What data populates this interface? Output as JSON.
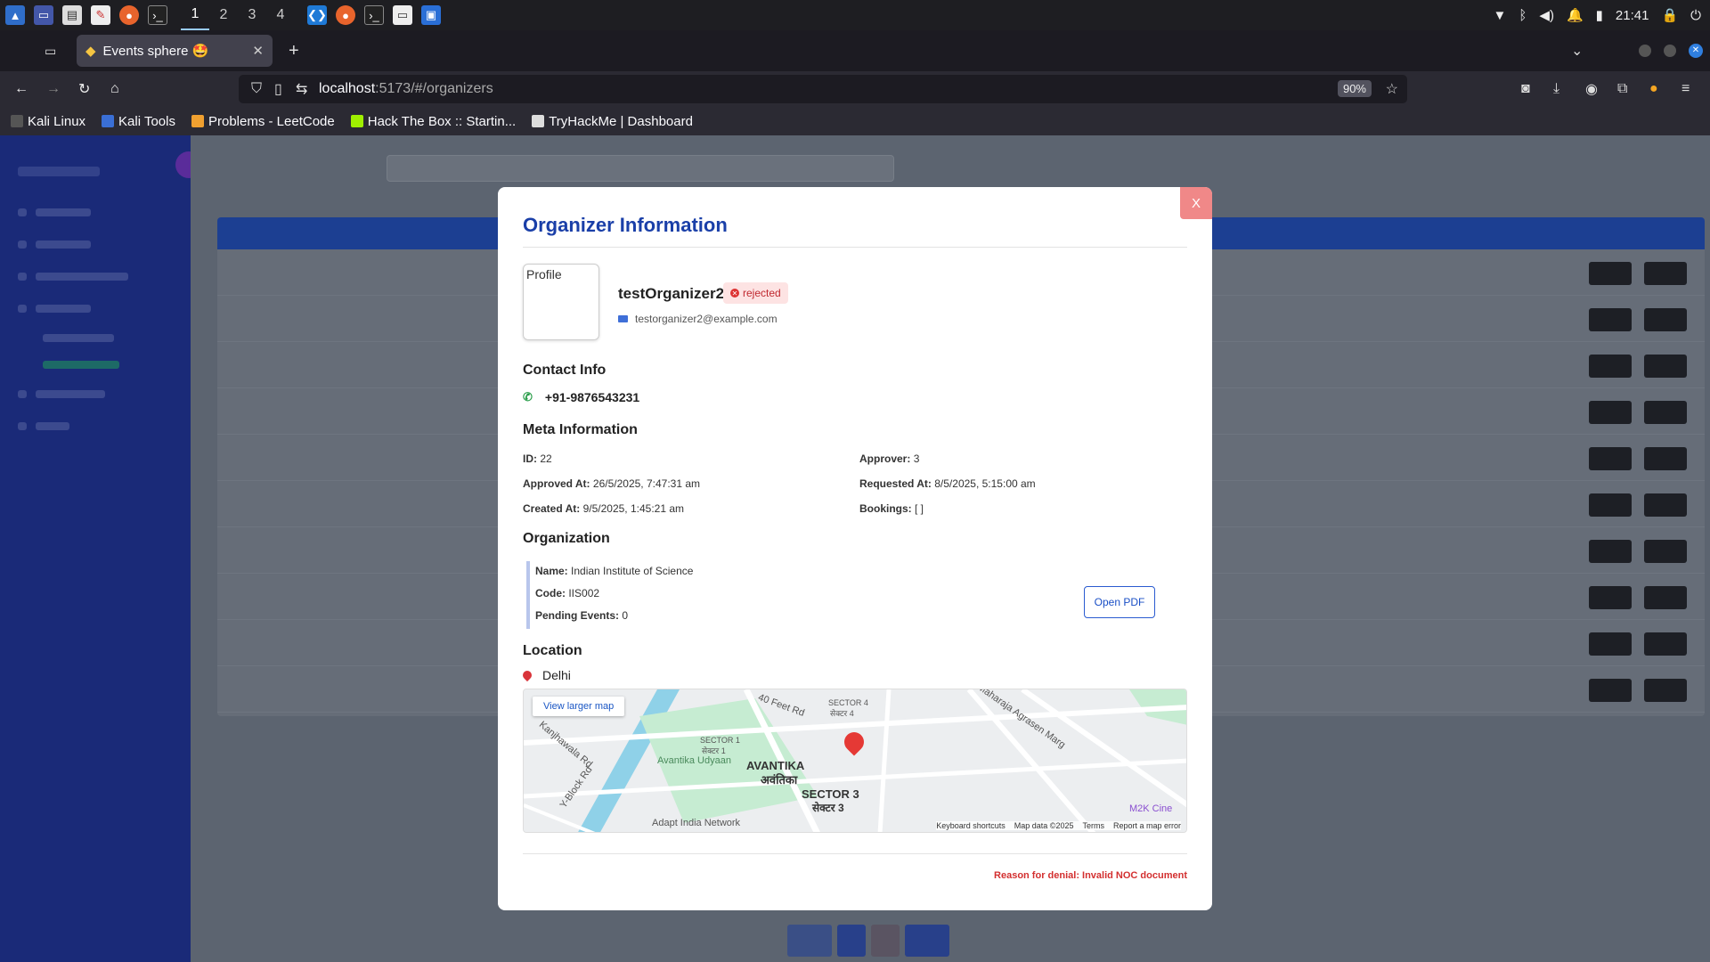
{
  "taskbar": {
    "workspaces": [
      "1",
      "2",
      "3",
      "4"
    ],
    "clock": "21:41"
  },
  "browser": {
    "tab_title": "Events sphere 🤩",
    "url_host": "localhost",
    "url_path": ":5173/#/organizers",
    "zoom": "90%",
    "bookmarks": [
      "Kali Linux",
      "Kali Tools",
      "Problems - LeetCode",
      "Hack The Box :: Startin...",
      "TryHackMe | Dashboard"
    ]
  },
  "modal": {
    "close_label": "X",
    "title": "Organizer Information",
    "profile_label": "Profile",
    "name": "testOrganizer2",
    "status": "rejected",
    "email": "testorganizer2@example.com",
    "contact_heading": "Contact Info",
    "phone": "+91-9876543231",
    "meta_heading": "Meta Information",
    "meta": {
      "id_label": "ID:",
      "id": "22",
      "approver_label": "Approver:",
      "approver": "3",
      "approved_label": "Approved At:",
      "approved": "26/5/2025, 7:47:31 am",
      "requested_label": "Requested At:",
      "requested": "8/5/2025, 5:15:00 am",
      "created_label": "Created At:",
      "created": "9/5/2025, 1:45:21 am",
      "bookings_label": "Bookings:",
      "bookings": "[ ]"
    },
    "org_heading": "Organization",
    "org": {
      "name_label": "Name:",
      "name": "Indian Institute of Science",
      "code_label": "Code:",
      "code": "IIS002",
      "pending_label": "Pending Events:",
      "pending": "0"
    },
    "open_pdf": "Open PDF",
    "location_heading": "Location",
    "location": "Delhi",
    "map": {
      "larger_map": "View larger map",
      "labels": [
        "AVANTIKA",
        "अवंतिका",
        "SECTOR 3",
        "सेक्टर 3",
        "Avantika Udyaan",
        "SECTOR 1",
        "सेक्टर 1",
        "SECTOR 4",
        "सेक्टर 4",
        "40 Feet Rd",
        "Maharaja Agrasen Marg",
        "Kanjhawala Rd",
        "Y-Block Rd",
        "Adapt India Network",
        "M2K Cine"
      ],
      "footer": [
        "Keyboard shortcuts",
        "Map data ©2025",
        "Terms",
        "Report a map error"
      ]
    },
    "denial": "Reason for denial: Invalid NOC document"
  }
}
